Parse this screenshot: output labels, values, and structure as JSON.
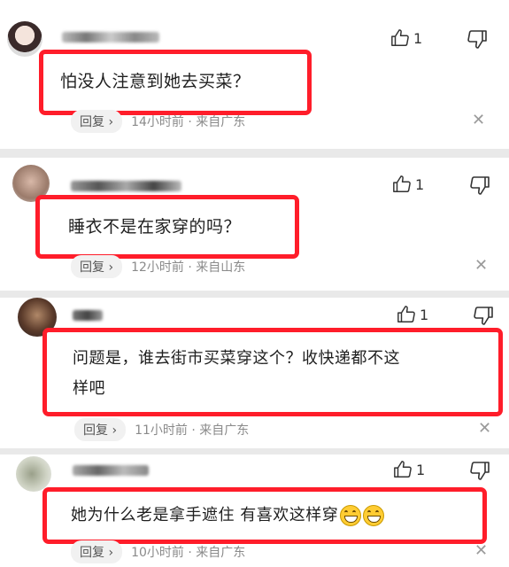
{
  "comments": [
    {
      "text": "怕没人注意到她去买菜？",
      "likes": "1",
      "reply_label": "回复 ›",
      "meta": "14小时前 · 来自广东",
      "close": "✕"
    },
    {
      "text": "睡衣不是在家穿的吗？",
      "likes": "1",
      "reply_label": "回复 ›",
      "meta": "12小时前 · 来自山东",
      "close": "✕"
    },
    {
      "text_line1": "问题是，谁去街市买菜穿这个？收快递都不这",
      "text_line2": "样吧",
      "likes": "1",
      "reply_label": "回复 ›",
      "meta": "11小时前 · 来自广东",
      "close": "✕"
    },
    {
      "text": "她为什么老是拿手遮住 有喜欢这样穿",
      "emojis": [
        "grin-emoji",
        "grin-emoji"
      ],
      "likes": "1",
      "reply_label": "回复 ›",
      "meta": "10小时前 · 来自广东",
      "close": "✕"
    }
  ],
  "colors": {
    "highlight_border": "#ff1d2a",
    "card_bg": "#ffffff",
    "separator_bg": "#e9e9e9",
    "meta_text": "#8a8a8a"
  }
}
